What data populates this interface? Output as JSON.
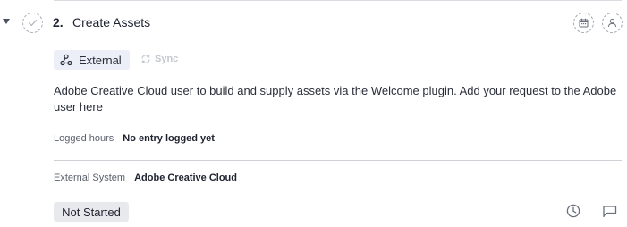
{
  "task": {
    "number": "2.",
    "title": "Create Assets"
  },
  "tags": {
    "external_label": "External",
    "sync_label": "Sync"
  },
  "description": "Adobe Creative Cloud user to build and supply assets via the Welcome plugin. Add your request to the Adobe user here",
  "logged_hours": {
    "label": "Logged hours",
    "value": "No entry logged yet"
  },
  "external_system": {
    "label": "External System",
    "value": "Adobe Creative Cloud"
  },
  "status": "Not Started",
  "icons": {
    "expand": "chevron-down-icon",
    "complete": "check-icon",
    "calendar": "calendar-icon",
    "assignee": "user-icon",
    "external": "webhook-icon",
    "sync": "sync-icon",
    "time": "clock-icon",
    "flag": "flag-icon"
  },
  "colors": {
    "text": "#1f2230",
    "muted": "#5b606c",
    "tag_bg": "#eceef8",
    "status_bg": "#e8e9ec",
    "disabled": "#c4c7cf"
  }
}
